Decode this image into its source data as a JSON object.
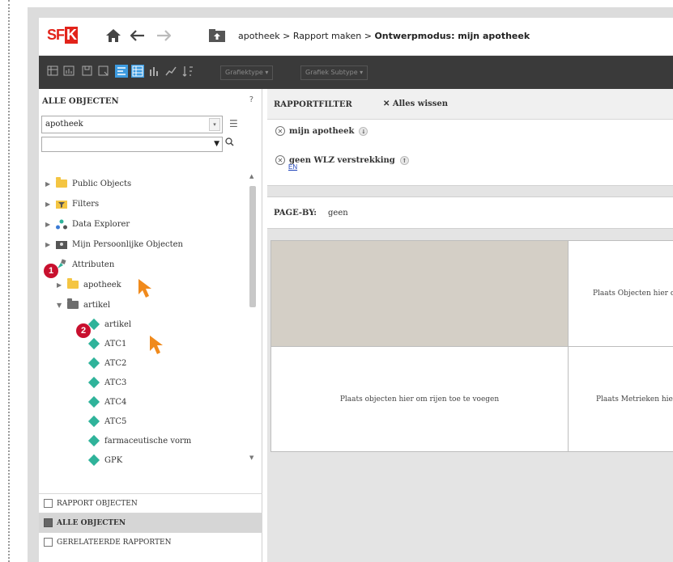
{
  "header": {
    "logo_text": "SF",
    "logo_box": "K",
    "breadcrumb_part1": "apotheek",
    "breadcrumb_sep": " > ",
    "breadcrumb_part2": "Rapport maken",
    "breadcrumb_current": "Ontwerpmodus: mijn apotheek"
  },
  "toolbar": {
    "graph_type": "Grafiektype",
    "graph_subtype": "Grafiek Subtype"
  },
  "left_panel": {
    "title": "ALLE OBJECTEN",
    "help": "?",
    "search_value": "apotheek",
    "tree": [
      {
        "label": "Public Objects"
      },
      {
        "label": "Filters"
      },
      {
        "label": "Data Explorer"
      },
      {
        "label": "Mijn Persoonlijke Objecten"
      },
      {
        "label": "Attributen"
      },
      {
        "label": "apotheek"
      },
      {
        "label": "artikel"
      },
      {
        "label": "artikel"
      },
      {
        "label": "ATC1"
      },
      {
        "label": "ATC2"
      },
      {
        "label": "ATC3"
      },
      {
        "label": "ATC4"
      },
      {
        "label": "ATC5"
      },
      {
        "label": "farmaceutische vorm"
      },
      {
        "label": "GPK"
      }
    ],
    "badges": [
      "1",
      "2"
    ],
    "accordion": [
      {
        "label": "RAPPORT OBJECTEN"
      },
      {
        "label": "ALLE OBJECTEN"
      },
      {
        "label": "GERELATEERDE RAPPORTEN"
      }
    ]
  },
  "report_filter": {
    "title": "RAPPORTFILTER",
    "clear_label": "Alles wissen",
    "filters": [
      {
        "label": "mijn apotheek"
      },
      {
        "label": "geen WLZ verstrekking"
      }
    ],
    "operator": "EN"
  },
  "page_by": {
    "label": "PAGE-BY:",
    "value": "geen"
  },
  "grid": {
    "columns_placeholder": "Plaats Objecten hier om kolommen toe te voegen",
    "rows_placeholder": "Plaats objecten hier om rijen toe te voegen",
    "metrics_placeholder": "Plaats Metrieken hier"
  },
  "colors": {
    "brand_red": "#e2231a",
    "toolbar_bg": "#3a3a3a",
    "attribute_green": "#2fb39a",
    "badge_red": "#c8102e",
    "cursor_orange": "#f08a1c"
  }
}
